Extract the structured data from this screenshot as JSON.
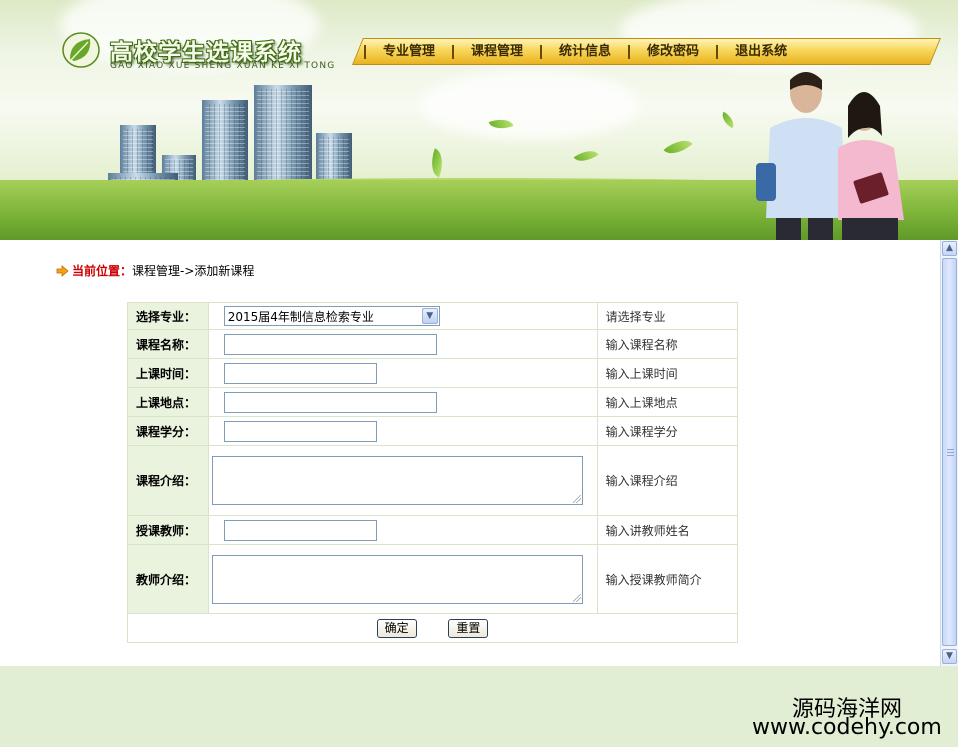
{
  "header": {
    "title": "高校学生选课系统",
    "subtitle": "GAO XIAO XUE SHENG XUAN KE XI TONG",
    "nav": [
      {
        "label": "专业管理"
      },
      {
        "label": "课程管理"
      },
      {
        "label": "统计信息"
      },
      {
        "label": "修改密码"
      },
      {
        "label": "退出系统"
      }
    ]
  },
  "breadcrumb": {
    "label": "当前位置：",
    "path": "课程管理->添加新课程"
  },
  "form": {
    "rows": [
      {
        "label": "选择专业：",
        "type": "select",
        "value": "2015届4年制信息检索专业",
        "hint": "请选择专业"
      },
      {
        "label": "课程名称：",
        "type": "text",
        "value": "",
        "hint": "输入课程名称"
      },
      {
        "label": "上课时间：",
        "type": "text",
        "value": "",
        "hint": "输入上课时间"
      },
      {
        "label": "上课地点：",
        "type": "text",
        "value": "",
        "hint": "输入上课地点"
      },
      {
        "label": "课程学分：",
        "type": "text",
        "value": "",
        "hint": "输入课程学分"
      },
      {
        "label": "课程介绍：",
        "type": "textarea",
        "value": "",
        "hint": "输入课程介绍"
      },
      {
        "label": "授课教师：",
        "type": "text",
        "value": "",
        "hint": "输入讲教师姓名"
      },
      {
        "label": "教师介绍：",
        "type": "textarea",
        "value": "",
        "hint": "输入授课教师简介"
      }
    ],
    "submit_label": "确定",
    "reset_label": "重置"
  },
  "watermark": {
    "line1": "源码海洋网",
    "line2": "www.codehy.com"
  },
  "colors": {
    "breadcrumb_label": "#cc0000",
    "label_cell_bg": "#e9f3dd",
    "nav_gold": "#f8d65a",
    "footer_bg": "#e1eed4"
  }
}
